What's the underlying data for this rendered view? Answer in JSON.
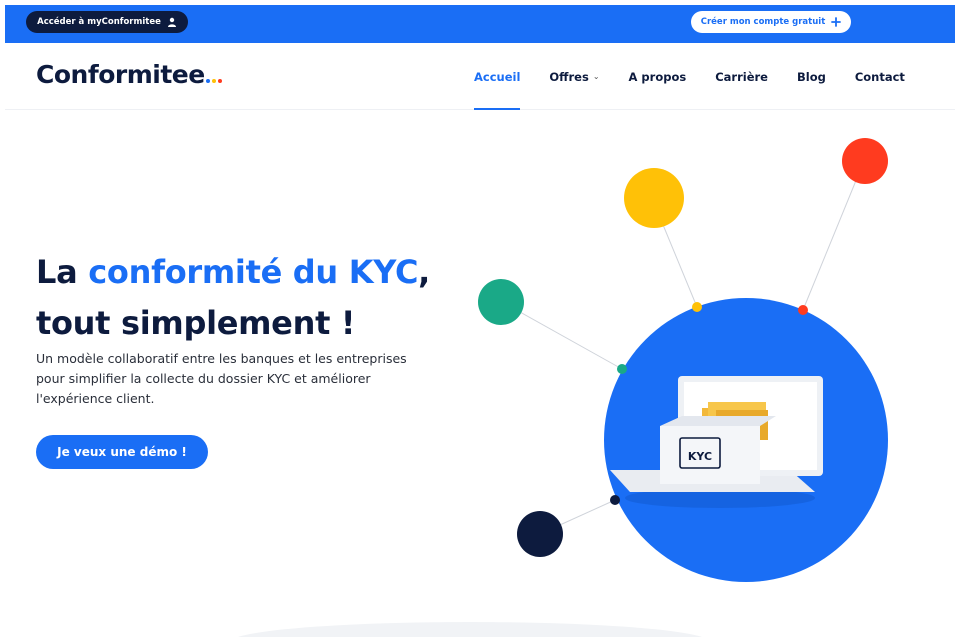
{
  "topbar": {
    "account_label": "Accéder à myConformitee",
    "create_label": "Créer mon compte gratuit",
    "color": "#1a6ef5"
  },
  "brand": {
    "name": "Conformitee",
    "logo_dot_colors": [
      "#1a6ef5",
      "#ffc107",
      "#ff3b1f"
    ]
  },
  "nav": {
    "items": [
      {
        "label": "Accueil",
        "active": true
      },
      {
        "label": "Offres",
        "has_dropdown": true
      },
      {
        "label": "A propos"
      },
      {
        "label": "Carrière"
      },
      {
        "label": "Blog"
      },
      {
        "label": "Contact"
      }
    ]
  },
  "hero": {
    "title_part1": "La ",
    "title_accent": "conformité du KYC",
    "title_part2": ",",
    "title_line2": "tout simplement !",
    "description": "Un modèle collaboratif entre les banques et les entreprises pour simplifier la collecte du dossier KYC et améliorer l'expérience client.",
    "cta_label": "Je veux une démo !"
  },
  "illustration": {
    "badge_text": "KYC",
    "icons": [
      "user-icon",
      "plus-icon",
      "chevron-down-icon"
    ],
    "colors": {
      "main_circle": "#1a6ef5",
      "yellow": "#ffc107",
      "red": "#ff3b1f",
      "green": "#1aa987",
      "navy": "#0d1b3e"
    }
  }
}
